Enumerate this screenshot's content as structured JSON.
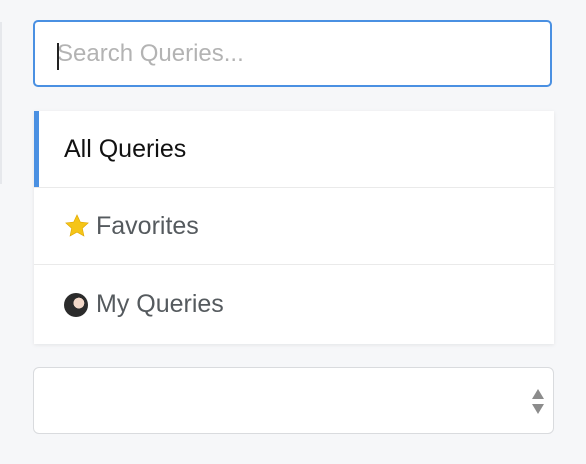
{
  "search": {
    "placeholder": "Search Queries...",
    "value": ""
  },
  "nav": {
    "items": [
      {
        "label": "All Queries",
        "icon": "",
        "active": true
      },
      {
        "label": "Favorites",
        "icon": "star-icon",
        "active": false
      },
      {
        "label": "My Queries",
        "icon": "avatar",
        "active": false
      }
    ]
  },
  "filter_select": {
    "value": ""
  },
  "colors": {
    "accent": "#4a90e2",
    "star": "#f5c518",
    "background": "#f6f7f9"
  }
}
